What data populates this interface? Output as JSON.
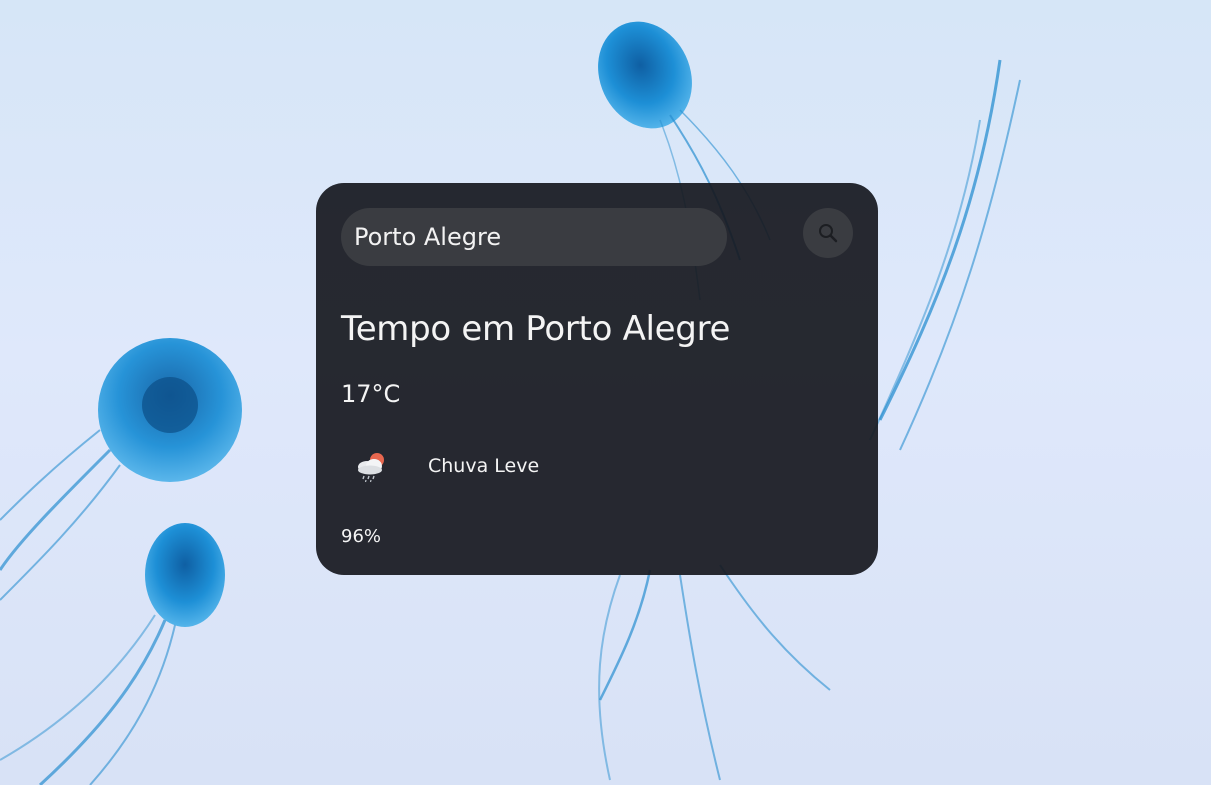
{
  "search": {
    "value": "Porto Alegre",
    "button_icon": "search-icon"
  },
  "weather": {
    "title": "Tempo em Porto Alegre",
    "temperature": "17°C",
    "description": "Chuva Leve",
    "icon": "light-rain-cloud-sun-icon",
    "humidity": "96%"
  },
  "background": {
    "theme": "blue jellyfish",
    "colors": {
      "sky": "#dbe7f8",
      "jellyfish": "#1e8fd4",
      "card": "#16181e",
      "input": "#3a3c41",
      "text": "#f4f4f4"
    }
  }
}
